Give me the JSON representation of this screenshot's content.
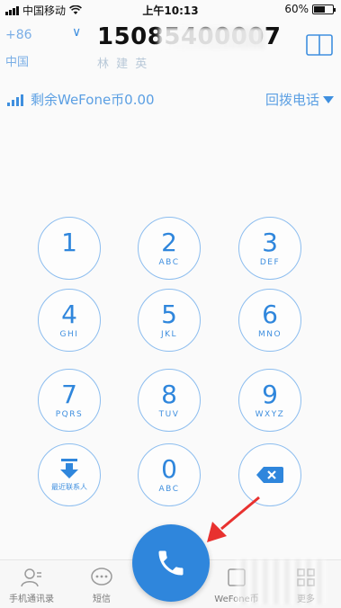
{
  "status_bar": {
    "carrier": "中国移动",
    "time": "上午10:13",
    "battery": "60%",
    "battery_level": 0.6
  },
  "header": {
    "country_code": "+86",
    "country_name": "中国",
    "phone_number": "15085400007",
    "contact_name": "林 建 英"
  },
  "balance": {
    "text": "剩余WeFone币0.00",
    "callback_label": "回拨电话"
  },
  "keypad": {
    "keys": [
      {
        "digit": "1",
        "letters": ""
      },
      {
        "digit": "2",
        "letters": "ABC"
      },
      {
        "digit": "3",
        "letters": "DEF"
      },
      {
        "digit": "4",
        "letters": "GHI"
      },
      {
        "digit": "5",
        "letters": "JKL"
      },
      {
        "digit": "6",
        "letters": "MNO"
      },
      {
        "digit": "7",
        "letters": "PQRS"
      },
      {
        "digit": "8",
        "letters": "TUV"
      },
      {
        "digit": "9",
        "letters": "WXYZ"
      },
      {
        "digit": "0",
        "letters": "ABC"
      }
    ],
    "recent_label": "最近联系人"
  },
  "tabs": {
    "contacts": "手机通讯录",
    "sms": "短信",
    "wefone": "WeFone币",
    "more": "更多"
  },
  "colors": {
    "accent": "#2f86dc",
    "key_border": "#8cbdef",
    "annotation": "#e8312f"
  }
}
